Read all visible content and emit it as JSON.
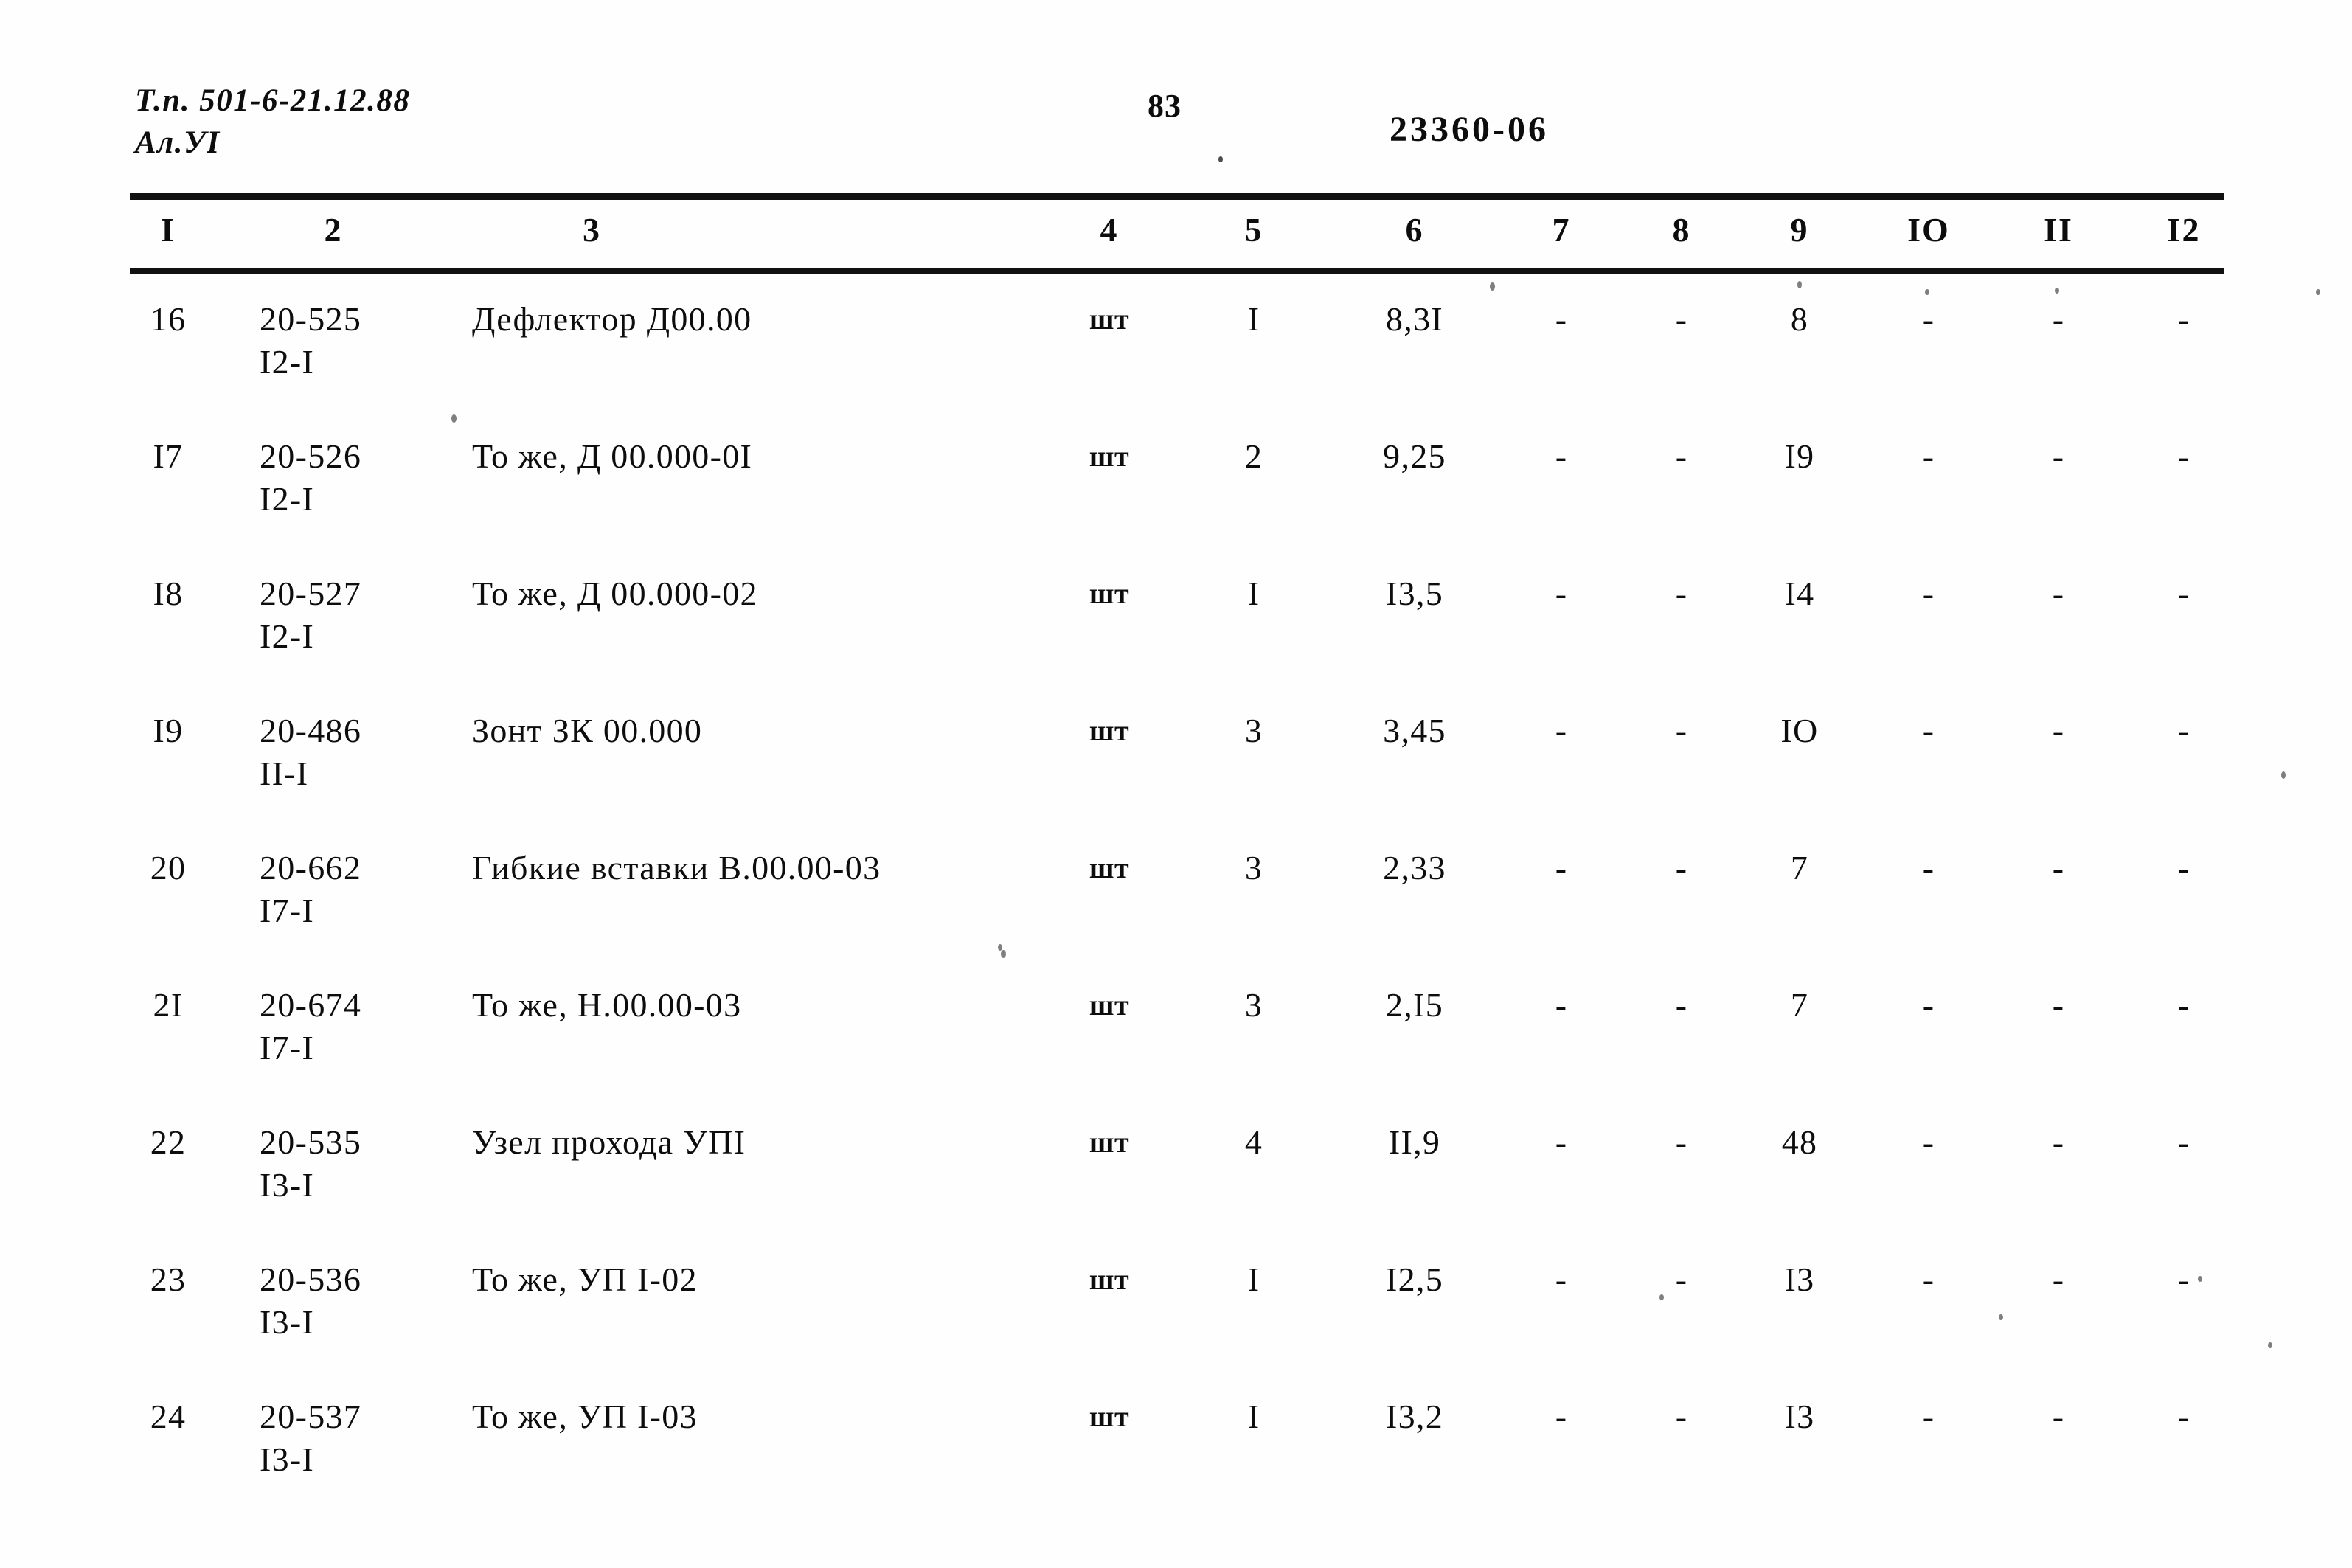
{
  "header": {
    "left_line1": "Т.п. 501-6-21.12.88",
    "left_line2": "Ал.УI",
    "page_number": "83",
    "doc_code": "23360-06"
  },
  "table": {
    "column_headers": [
      "I",
      "2",
      "3",
      "4",
      "5",
      "6",
      "7",
      "8",
      "9",
      "IO",
      "II",
      "I2"
    ],
    "rows": [
      {
        "n": "16",
        "code_main": "20-525",
        "code_sub": "I2-I",
        "name": "Дефлектор Д00.00",
        "unit": "шт",
        "c5": "I",
        "c6": "8,3I",
        "c7": "-",
        "c8": "-",
        "c9": "8",
        "c10": "-",
        "c11": "-",
        "c12": "-"
      },
      {
        "n": "I7",
        "code_main": "20-526",
        "code_sub": "I2-I",
        "name": "То же, Д 00.000-0I",
        "unit": "шт",
        "c5": "2",
        "c6": "9,25",
        "c7": "-",
        "c8": "-",
        "c9": "I9",
        "c10": "-",
        "c11": "-",
        "c12": "-"
      },
      {
        "n": "I8",
        "code_main": "20-527",
        "code_sub": "I2-I",
        "name": "То же, Д 00.000-02",
        "unit": "шт",
        "c5": "I",
        "c6": "I3,5",
        "c7": "-",
        "c8": "-",
        "c9": "I4",
        "c10": "-",
        "c11": "-",
        "c12": "-"
      },
      {
        "n": "I9",
        "code_main": "20-486",
        "code_sub": "II-I",
        "name": "Зонт ЗК 00.000",
        "unit": "шт",
        "c5": "3",
        "c6": "3,45",
        "c7": "-",
        "c8": "-",
        "c9": "IO",
        "c10": "-",
        "c11": "-",
        "c12": "-"
      },
      {
        "n": "20",
        "code_main": "20-662",
        "code_sub": "I7-I",
        "name": "Гибкие вставки В.00.00-03",
        "unit": "шт",
        "c5": "3",
        "c6": "2,33",
        "c7": "-",
        "c8": "-",
        "c9": "7",
        "c10": "-",
        "c11": "-",
        "c12": "-"
      },
      {
        "n": "2I",
        "code_main": "20-674",
        "code_sub": "I7-I",
        "name": "То же, Н.00.00-03",
        "unit": "шт",
        "c5": "3",
        "c6": "2,I5",
        "c7": "-",
        "c8": "-",
        "c9": "7",
        "c10": "-",
        "c11": "-",
        "c12": "-"
      },
      {
        "n": "22",
        "code_main": "20-535",
        "code_sub": "I3-I",
        "name": "Узел прохода УПI",
        "unit": "шт",
        "c5": "4",
        "c6": "II,9",
        "c7": "-",
        "c8": "-",
        "c9": "48",
        "c10": "-",
        "c11": "-",
        "c12": "-"
      },
      {
        "n": "23",
        "code_main": "20-536",
        "code_sub": "I3-I",
        "name": "То же, УП I-02",
        "unit": "шт",
        "c5": "I",
        "c6": "I2,5",
        "c7": "-",
        "c8": "-",
        "c9": "I3",
        "c10": "-",
        "c11": "-",
        "c12": "-"
      },
      {
        "n": "24",
        "code_main": "20-537",
        "code_sub": "I3-I",
        "name": "То же, УП I-03",
        "unit": "шт",
        "c5": "I",
        "c6": "I3,2",
        "c7": "-",
        "c8": "-",
        "c9": "I3",
        "c10": "-",
        "c11": "-",
        "c12": "-"
      }
    ]
  }
}
